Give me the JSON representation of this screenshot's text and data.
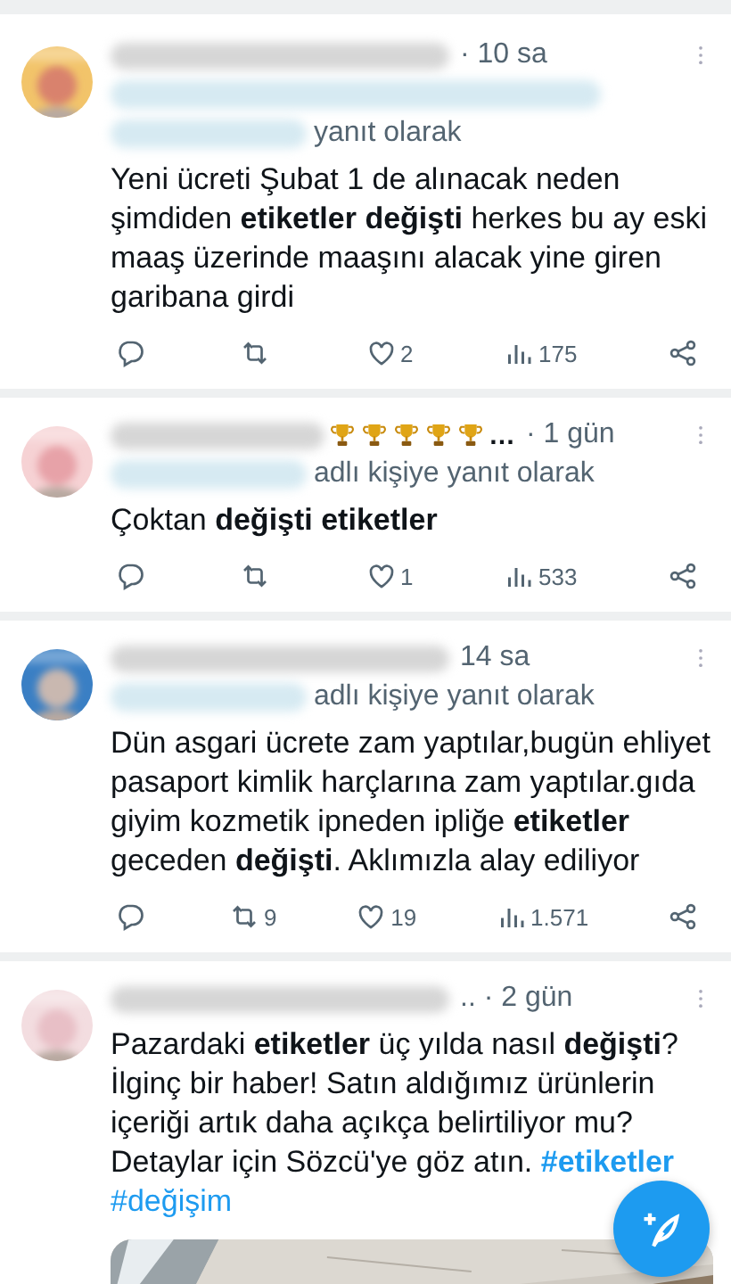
{
  "tweets": [
    {
      "time": "· 10 sa",
      "reply_to": "yanıt olarak",
      "handle_line": true,
      "text": "Yeni ücreti Şubat 1 de alınacak neden şimdiden **etiketler değişti** herkes bu ay eski maaş üzerinde maaşını alacak yine giren garibana girdi",
      "likes": "2",
      "views": "175"
    },
    {
      "time": "· 1 gün",
      "badges": [
        {
          "kind": "trophy"
        },
        {
          "kind": "trophy"
        },
        {
          "kind": "trophy"
        },
        {
          "kind": "trophy"
        },
        {
          "kind": "trophy"
        }
      ],
      "name_suffix": "…",
      "reply_to": "adlı kişiye yanıt olarak",
      "text": "Çoktan **değişti etiketler**",
      "likes": "1",
      "views": "533"
    },
    {
      "time": "14 sa",
      "reply_to": "adlı kişiye yanıt olarak",
      "text": "Dün asgari ücrete zam yaptılar,bugün ehliyet pasaport kimlik harçlarına zam yaptılar.gıda giyim kozmetik ipneden ipliğe **etiketler** geceden **değişti**. Aklımızla alay ediliyor",
      "retweets": "9",
      "likes": "19",
      "views": "1.571"
    },
    {
      "time": ".. · 2 gün",
      "text": "Pazardaki **etiketler** üç yılda nasıl **değişti**? İlginç bir haber! Satın aldığımız ürünlerin içeriği artık daha açıkça belirtiliyor mu? Detaylar için Sözcü'ye göz atın.",
      "hashtags": [
        {
          "label": "#etiketler",
          "bold": true
        },
        {
          "label": "#değişim",
          "bold": false
        }
      ]
    }
  ],
  "compose_button": {
    "kind": "compose"
  }
}
